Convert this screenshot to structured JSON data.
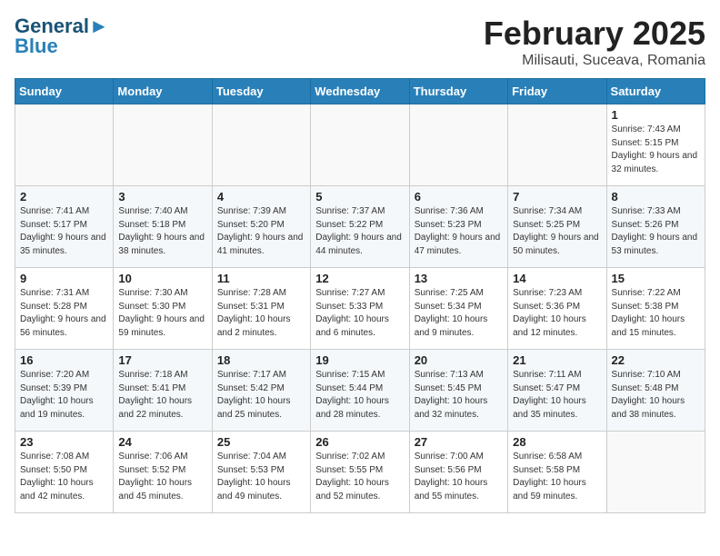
{
  "header": {
    "logo_line1": "General",
    "logo_line2": "Blue",
    "title": "February 2025",
    "subtitle": "Milisauti, Suceava, Romania"
  },
  "weekdays": [
    "Sunday",
    "Monday",
    "Tuesday",
    "Wednesday",
    "Thursday",
    "Friday",
    "Saturday"
  ],
  "weeks": [
    [
      {
        "day": "",
        "info": ""
      },
      {
        "day": "",
        "info": ""
      },
      {
        "day": "",
        "info": ""
      },
      {
        "day": "",
        "info": ""
      },
      {
        "day": "",
        "info": ""
      },
      {
        "day": "",
        "info": ""
      },
      {
        "day": "1",
        "info": "Sunrise: 7:43 AM\nSunset: 5:15 PM\nDaylight: 9 hours and 32 minutes."
      }
    ],
    [
      {
        "day": "2",
        "info": "Sunrise: 7:41 AM\nSunset: 5:17 PM\nDaylight: 9 hours and 35 minutes."
      },
      {
        "day": "3",
        "info": "Sunrise: 7:40 AM\nSunset: 5:18 PM\nDaylight: 9 hours and 38 minutes."
      },
      {
        "day": "4",
        "info": "Sunrise: 7:39 AM\nSunset: 5:20 PM\nDaylight: 9 hours and 41 minutes."
      },
      {
        "day": "5",
        "info": "Sunrise: 7:37 AM\nSunset: 5:22 PM\nDaylight: 9 hours and 44 minutes."
      },
      {
        "day": "6",
        "info": "Sunrise: 7:36 AM\nSunset: 5:23 PM\nDaylight: 9 hours and 47 minutes."
      },
      {
        "day": "7",
        "info": "Sunrise: 7:34 AM\nSunset: 5:25 PM\nDaylight: 9 hours and 50 minutes."
      },
      {
        "day": "8",
        "info": "Sunrise: 7:33 AM\nSunset: 5:26 PM\nDaylight: 9 hours and 53 minutes."
      }
    ],
    [
      {
        "day": "9",
        "info": "Sunrise: 7:31 AM\nSunset: 5:28 PM\nDaylight: 9 hours and 56 minutes."
      },
      {
        "day": "10",
        "info": "Sunrise: 7:30 AM\nSunset: 5:30 PM\nDaylight: 9 hours and 59 minutes."
      },
      {
        "day": "11",
        "info": "Sunrise: 7:28 AM\nSunset: 5:31 PM\nDaylight: 10 hours and 2 minutes."
      },
      {
        "day": "12",
        "info": "Sunrise: 7:27 AM\nSunset: 5:33 PM\nDaylight: 10 hours and 6 minutes."
      },
      {
        "day": "13",
        "info": "Sunrise: 7:25 AM\nSunset: 5:34 PM\nDaylight: 10 hours and 9 minutes."
      },
      {
        "day": "14",
        "info": "Sunrise: 7:23 AM\nSunset: 5:36 PM\nDaylight: 10 hours and 12 minutes."
      },
      {
        "day": "15",
        "info": "Sunrise: 7:22 AM\nSunset: 5:38 PM\nDaylight: 10 hours and 15 minutes."
      }
    ],
    [
      {
        "day": "16",
        "info": "Sunrise: 7:20 AM\nSunset: 5:39 PM\nDaylight: 10 hours and 19 minutes."
      },
      {
        "day": "17",
        "info": "Sunrise: 7:18 AM\nSunset: 5:41 PM\nDaylight: 10 hours and 22 minutes."
      },
      {
        "day": "18",
        "info": "Sunrise: 7:17 AM\nSunset: 5:42 PM\nDaylight: 10 hours and 25 minutes."
      },
      {
        "day": "19",
        "info": "Sunrise: 7:15 AM\nSunset: 5:44 PM\nDaylight: 10 hours and 28 minutes."
      },
      {
        "day": "20",
        "info": "Sunrise: 7:13 AM\nSunset: 5:45 PM\nDaylight: 10 hours and 32 minutes."
      },
      {
        "day": "21",
        "info": "Sunrise: 7:11 AM\nSunset: 5:47 PM\nDaylight: 10 hours and 35 minutes."
      },
      {
        "day": "22",
        "info": "Sunrise: 7:10 AM\nSunset: 5:48 PM\nDaylight: 10 hours and 38 minutes."
      }
    ],
    [
      {
        "day": "23",
        "info": "Sunrise: 7:08 AM\nSunset: 5:50 PM\nDaylight: 10 hours and 42 minutes."
      },
      {
        "day": "24",
        "info": "Sunrise: 7:06 AM\nSunset: 5:52 PM\nDaylight: 10 hours and 45 minutes."
      },
      {
        "day": "25",
        "info": "Sunrise: 7:04 AM\nSunset: 5:53 PM\nDaylight: 10 hours and 49 minutes."
      },
      {
        "day": "26",
        "info": "Sunrise: 7:02 AM\nSunset: 5:55 PM\nDaylight: 10 hours and 52 minutes."
      },
      {
        "day": "27",
        "info": "Sunrise: 7:00 AM\nSunset: 5:56 PM\nDaylight: 10 hours and 55 minutes."
      },
      {
        "day": "28",
        "info": "Sunrise: 6:58 AM\nSunset: 5:58 PM\nDaylight: 10 hours and 59 minutes."
      },
      {
        "day": "",
        "info": ""
      }
    ]
  ]
}
